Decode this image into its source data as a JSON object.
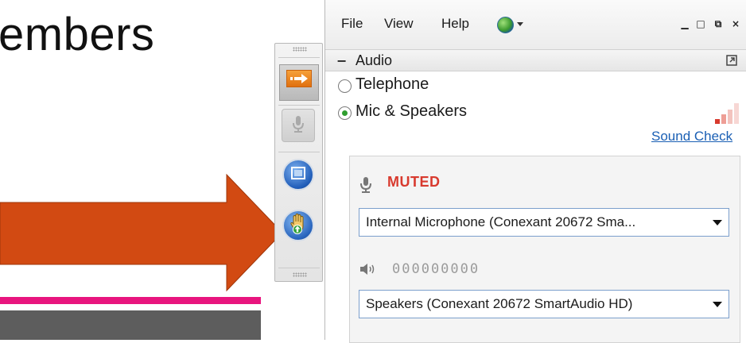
{
  "slide": {
    "title_fragment": "embers"
  },
  "panel": {
    "menu": [
      "File",
      "View",
      "Help"
    ],
    "window_controls": {
      "minimize": "▁",
      "maximize": "□",
      "restore": "⧉",
      "close": "×"
    },
    "audio": {
      "section_title": "Audio",
      "collapse_glyph": "−",
      "options": [
        {
          "label": "Telephone",
          "selected": false
        },
        {
          "label": "Mic & Speakers",
          "selected": true
        }
      ],
      "sound_check_link": "Sound Check",
      "mic_status": "MUTED",
      "microphone_select": "Internal Microphone (Conexant 20672 Sma...",
      "speaker_level": "000000000",
      "speaker_select": "Speakers (Conexant 20672 SmartAudio HD)"
    }
  },
  "colors": {
    "slide_arrow": "#d24a12",
    "pink_rule": "#e8157e",
    "gray_bar": "#5d5d5d",
    "link": "#1a5fb4",
    "muted": "#d83a2e",
    "radio_selected": "#2f9e2f",
    "select_border": "#7c9fcc"
  },
  "icons": {
    "toolbar": [
      "collapse-arrow-icon",
      "microphone-icon",
      "video-icon",
      "raise-hand-icon"
    ],
    "panel": [
      "globe-icon",
      "microphone-icon",
      "speaker-icon",
      "popout-icon"
    ]
  }
}
